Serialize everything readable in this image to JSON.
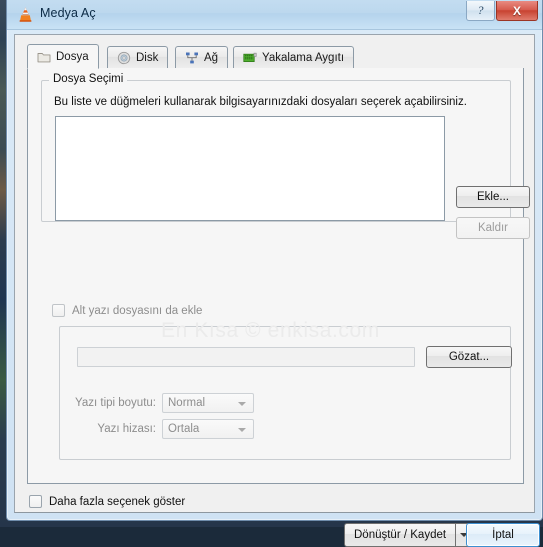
{
  "window": {
    "title": "Medya Aç",
    "app_icon": "vlc-cone-icon",
    "help_label": "?",
    "close_label": "X",
    "accent_color": "#3d8fd0",
    "titlebar_color": "#bcd8ee",
    "close_color": "#c7412f"
  },
  "tabs": [
    {
      "label": "Dosya",
      "icon": "folder-icon",
      "selected": true
    },
    {
      "label": "Disk",
      "icon": "disc-icon",
      "selected": false
    },
    {
      "label": "Ağ",
      "icon": "network-icon",
      "selected": false
    },
    {
      "label": "Yakalama Aygıtı",
      "icon": "capture-card-icon",
      "selected": false
    }
  ],
  "file_group": {
    "title": "Dosya Seçimi",
    "help_text": "Bu liste ve düğmeleri kullanarak bilgisayarınızdaki dosyaları seçerek açabilirsiniz.",
    "list_items": [],
    "add_button": "Ekle...",
    "remove_button": "Kaldır",
    "remove_enabled": false
  },
  "subtitle": {
    "checkbox_label": "Alt yazı dosyasını da ekle",
    "checkbox_checked": false,
    "checkbox_enabled": false,
    "path_value": "",
    "path_placeholder": "",
    "browse_button": "Gözat...",
    "fontsize_label": "Yazı tipi boyutu:",
    "fontsize_value": "Normal",
    "align_label": "Yazı hizası:",
    "align_value": "Ortala",
    "controls_enabled": false
  },
  "footer": {
    "more_options_label": "Daha fazla seçenek göster",
    "more_options_checked": false,
    "primary_button": "Dönüştür / Kaydet",
    "primary_dropdown_icon": "chevron-down-icon",
    "cancel_button": "İptal"
  },
  "watermark": {
    "text": "En Kısa © enkisa.com"
  }
}
